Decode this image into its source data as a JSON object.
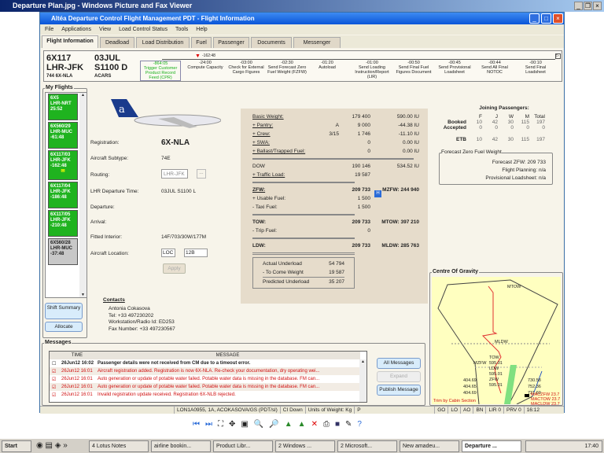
{
  "viewer": {
    "title": "Departure Plan.jpg - Windows Picture and Fax Viewer"
  },
  "app": {
    "title": "Altéa Departure Control Flight Management PDT - Flight Information",
    "menu": [
      "File",
      "Applications",
      "View",
      "Load Control Status",
      "Tools",
      "Help"
    ],
    "tabs": [
      "Flight Information",
      "Deadload",
      "Load Distribution",
      "Fuel",
      "Passenger",
      "Documents",
      "Messenger"
    ]
  },
  "flight": {
    "number": "6X117",
    "route": "LHR-JFK",
    "aircraft": "744 6X-NLA",
    "date": "03JUL",
    "std": "S1100 D",
    "source": "ACARS",
    "current_marker": "-162:48",
    "milestones": [
      {
        "time": "-864:05",
        "label": "Trigger Customer Product Record Feed (CPR)"
      },
      {
        "time": "-24:00",
        "label": "Compute Capacity"
      },
      {
        "time": "-03:00",
        "label": "Check for External Cargo Figures"
      },
      {
        "time": "-02:30",
        "label": "Send Forecast Zero Fuel Weight (FZFW)"
      },
      {
        "time": "-01:20",
        "label": "Autoload"
      },
      {
        "time": "-01:00",
        "label": "Send Loading Instruction/Report (LIR)"
      },
      {
        "time": "-00:50",
        "label": "Send Final Fuel Figures Document"
      },
      {
        "time": "-00:45",
        "label": "Send Provisional Loadsheet"
      },
      {
        "time": "-00:44",
        "label": "Send All Final NOTOC"
      },
      {
        "time": "-00:10",
        "label": "Send Final Loadsheet"
      }
    ]
  },
  "my_flights": {
    "title": "My Flights",
    "items": [
      {
        "l1": "6X5",
        "l2": "LHR-NRT",
        "l3": "25:52"
      },
      {
        "l1": "6X560/29",
        "l2": "LHR-MUC",
        "l3": "-61:48"
      },
      {
        "l1": "6X117/03",
        "l2": "LHR-JFK",
        "l3": "-162:48"
      },
      {
        "l1": "6X117/04",
        "l2": "LHR-JFK",
        "l3": "-186:48"
      },
      {
        "l1": "6X117/05",
        "l2": "LHR-JFK",
        "l3": "-210:48"
      },
      {
        "l1": "6X560/28",
        "l2": "LHR-MUC",
        "l3": "-37:48"
      }
    ],
    "shift_summary": "Shift Summary",
    "allocate": "Allocate"
  },
  "aircraft": {
    "registration_label": "Registration:",
    "registration": "6X-NLA",
    "subtype_label": "Aircraft Subtype:",
    "subtype": "74E",
    "routing_label": "Routing:",
    "routing": "LHR-JFK",
    "routing_btn": "...",
    "dep_time_label": "LHR Departure Time:",
    "dep_time": "03JUL S1100 L",
    "departure_label": "Departure:",
    "arrival_label": "Arrival:",
    "interior_label": "Fitted Interior:",
    "interior": "14F/703/30W/177M",
    "location_label": "Aircraft Location:",
    "location_a": "LOC",
    "location_b": "12B",
    "apply": "Apply"
  },
  "contacts": {
    "title": "Contacts",
    "name": "Antonia Cokasova",
    "tel": "Tel: +33 497230202",
    "workstation": "Workstation/Radio Id: ED253",
    "fax": "Fax Number: +33 497230567"
  },
  "weights": {
    "rows1": [
      {
        "label": "Basic Weight:",
        "mid": "",
        "val": "179 400",
        "idx": "590.00 IU"
      },
      {
        "label": "+ Pantry:",
        "mid": "A",
        "val": "9 000",
        "idx": "-44.38 IU"
      },
      {
        "label": "+ Crew:",
        "mid": "3/15",
        "val": "1 746",
        "idx": "-11.10 IU"
      },
      {
        "label": "+ SWA:",
        "mid": "",
        "val": "0",
        "idx": "0.00 IU"
      },
      {
        "label": "+ Ballast/Trapped Fuel:",
        "mid": "",
        "val": "0",
        "idx": "0.00 IU"
      }
    ],
    "dow": {
      "label": "DOW",
      "val": "190 146",
      "idx": "534.52 IU"
    },
    "traffic": {
      "label": "+ Traffic Load:",
      "val": "19 587"
    },
    "zfw": {
      "label": "ZFW:",
      "val": "209 733",
      "max": "MZFW: 244 940"
    },
    "usable": {
      "label": "+ Usable Fuel:",
      "val": "1 500",
      "badge": "H"
    },
    "taxi": {
      "label": "- Taxi Fuel:",
      "val": "1 500"
    },
    "tow": {
      "label": "TOW:",
      "val": "209 733",
      "max": "MTOW: 397 210"
    },
    "trip": {
      "label": "- Trip Fuel:",
      "val": "0"
    },
    "ldw": {
      "label": "LDW:",
      "val": "209 733",
      "max": "MLDW: 285 763"
    },
    "underload": [
      {
        "label": "Actual Underload",
        "val": "54 794"
      },
      {
        "label": "- To Come Weight",
        "val": "19 587"
      },
      {
        "label": "Predicted Underload",
        "val": "35 207"
      }
    ]
  },
  "passengers": {
    "title": "Joining Passengers:",
    "cols": [
      "F",
      "J",
      "W",
      "M",
      "Total"
    ],
    "rows": [
      {
        "label": "Booked",
        "vals": [
          "10",
          "42",
          "30",
          "115",
          "197"
        ]
      },
      {
        "label": "Accepted",
        "vals": [
          "0",
          "0",
          "0",
          "0",
          "0"
        ]
      },
      {
        "label": "ETB",
        "vals": [
          "10",
          "42",
          "30",
          "115",
          "197"
        ]
      }
    ]
  },
  "fzfw": {
    "title": "Forecast Zero Fuel Weight",
    "forecast": "Forecast ZFW: 209 733",
    "planning": "Flight Planning: n/a",
    "provisional": "Provisional Loadsheet: n/a"
  },
  "cog": {
    "title": "Centre Of Gravity",
    "mtow": "MTOW",
    "mldw": "MLDW",
    "mzfw": "MZFW",
    "tow": "TOW",
    "tow_v": "595.01",
    "ldw": "LDW",
    "ldw_v": "595.01",
    "zfw": "ZFW",
    "zfw_v": "595.01",
    "l1": "404.69",
    "l2": "404.65",
    "l3": "404.69",
    "r1": "730.58",
    "r2": "752.36",
    "r3": "731.60",
    "mac1": "MACZFW 23.7",
    "mac2": "MACTOW 23.7",
    "mac3": "MACLDW 23.7",
    "trim": "Trim by Cabin Section"
  },
  "messages": {
    "title": "Messages",
    "col_time": "TIME",
    "col_msg": "MESSAGE",
    "rows": [
      {
        "checked": false,
        "time": "26Jun12 16:02",
        "text": "Passenger details were not received from CM due to a timeout error.",
        "style": "bold"
      },
      {
        "checked": true,
        "time": "26Jun12 16:01",
        "text": "Aircraft registration added. Registration is now 6X-NLA. Re-check your documentation, dry operating wei...",
        "style": "red"
      },
      {
        "checked": true,
        "time": "26Jun12 16:01",
        "text": "Auto generation or update of potable water failed. Potable water data is missing in the database. FM can...",
        "style": "red"
      },
      {
        "checked": true,
        "time": "26Jun12 16:01",
        "text": "Auto generation or update of potable water failed. Potable water data is missing in the database. FM can...",
        "style": "red"
      },
      {
        "checked": true,
        "time": "26Jun12 16:01",
        "text": "Invalid registration update received. Registration 6X-NLB rejected.",
        "style": "red"
      }
    ],
    "all": "All Messages",
    "expand": "Expand",
    "publish": "Publish Message"
  },
  "status": {
    "user": "LON1A0955, 1A, ACOKASOVA/GS (PDT/sl)",
    "ci": "CI Down",
    "units": "Units of Weight: Kg",
    "p": "P",
    "go": "GO",
    "lo": "LO",
    "ao": "AO",
    "bn": "BN",
    "lir": "LIR 0",
    "prv": "PRV 0",
    "time": "16:12"
  },
  "taskbar": {
    "start": "Start",
    "items": [
      "4 Lotus Notes",
      "airline bookin...",
      "Product Libr...",
      "2 Windows ...",
      "2 Microsoft...",
      "New amadeu...",
      "Departure ..."
    ],
    "clock": "17:40"
  }
}
